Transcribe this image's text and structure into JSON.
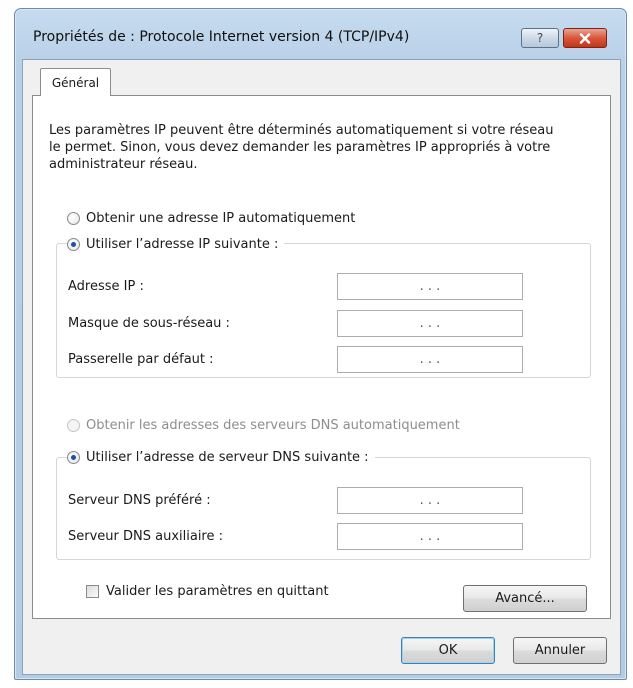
{
  "window": {
    "title": "Propriétés de : Protocole Internet version 4 (TCP/IPv4)",
    "help_label": "?",
    "close_icon": "close-icon"
  },
  "tabs": [
    "Général"
  ],
  "intro_text": "Les paramètres IP peuvent être déterminés automatiquement si votre réseau le permet. Sinon, vous devez demander les paramètres IP appropriés à votre administrateur réseau.",
  "ip_section": {
    "auto_label": "Obtenir une adresse IP automatiquement",
    "manual_label": "Utiliser l’adresse IP suivante :",
    "selected": "manual",
    "fields": [
      {
        "label": "Adresse IP :",
        "value": ". . ."
      },
      {
        "label": "Masque de sous-réseau :",
        "value": ". . ."
      },
      {
        "label": "Passerelle par défaut :",
        "value": ". . ."
      }
    ]
  },
  "dns_section": {
    "auto_label": "Obtenir les adresses des serveurs DNS automatiquement",
    "auto_disabled": true,
    "manual_label": "Utiliser l’adresse de serveur DNS suivante :",
    "selected": "manual",
    "fields": [
      {
        "label": "Serveur DNS préféré :",
        "value": ". . ."
      },
      {
        "label": "Serveur DNS auxiliaire :",
        "value": ". . ."
      }
    ]
  },
  "validate_on_exit": {
    "label": "Valider les paramètres en quittant",
    "checked": false
  },
  "buttons": {
    "advanced": "Avancé...",
    "ok": "OK",
    "cancel": "Annuler"
  },
  "colors": {
    "accent": "#1f4fa8",
    "close_button": "#c43519",
    "title_bar": "#b7cfe7"
  }
}
